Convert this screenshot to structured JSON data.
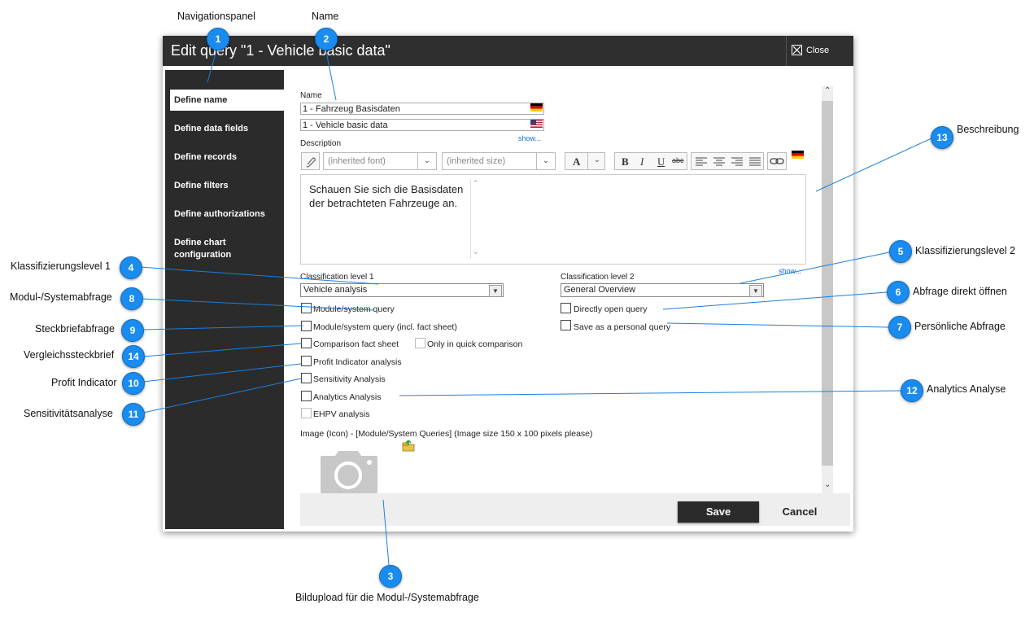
{
  "annotations": {
    "navigationspanel": "Navigationspanel",
    "name": "Name",
    "beschreibung": "Beschreibung",
    "klass1": "Klassifizierungslevel 1",
    "klass2": "Klassifizierungslevel 2",
    "modul": "Modul-/Systemabfrage",
    "abfrage_direkt": "Abfrage direkt öffnen",
    "steckbrief": "Steckbriefabfrage",
    "persoenlich": "Persönliche Abfrage",
    "vergleich": "Vergleichssteckbrief",
    "profit": "Profit Indicator",
    "analytics": "Analytics Analyse",
    "sensitivitaet": "Sensitivitätsanalyse",
    "bildupload": "Bildupload für die Modul-/Systemabfrage"
  },
  "badges": {
    "b1": "1",
    "b2": "2",
    "b3": "3",
    "b4": "4",
    "b5": "5",
    "b6": "6",
    "b7": "7",
    "b8": "8",
    "b9": "9",
    "b10": "10",
    "b11": "11",
    "b12": "12",
    "b13": "13",
    "b14": "14"
  },
  "dialog": {
    "title": "Edit query \"1 - Vehicle basic data\"",
    "close_label": "Close"
  },
  "sidebar": {
    "items": [
      {
        "label": "Define name"
      },
      {
        "label": "Define data fields"
      },
      {
        "label": "Define records"
      },
      {
        "label": "Define filters"
      },
      {
        "label": "Define authorizations"
      },
      {
        "label": "Define chart configuration"
      }
    ]
  },
  "form": {
    "name_label": "Name",
    "name_de": "1 - Fahrzeug Basisdaten",
    "name_en": "1 - Vehicle basic data",
    "show_link": "show...",
    "description_label": "Description",
    "font_placeholder": "(inherited font)",
    "size_placeholder": "(inherited size)",
    "toolbar": {
      "bold": "B",
      "italic": "I",
      "underline": "U",
      "strike": "abc",
      "font_color": "A"
    },
    "description_text": "Schauen Sie sich die Basisdaten der betrachteten Fahrzeuge an.",
    "show_link2": "show...",
    "class1_label": "Classification level 1",
    "class1_value": "Vehicle analysis",
    "class2_label": "Classification level 2",
    "class2_value": "General Overview",
    "checkboxes": {
      "module": "Module/system query",
      "module_fact": "Module/system query (incl. fact sheet)",
      "comparison": "Comparison fact sheet",
      "quick_comparison": "Only in quick comparison",
      "profit": "Profit Indicator analysis",
      "sensitivity": "Sensitivity Analysis",
      "analytics": "Analytics Analysis",
      "ehpv": "EHPV analysis",
      "directly_open": "Directly open query",
      "personal": "Save as a personal query"
    },
    "image_label": "Image (Icon) - [Module/System Queries] (Image size 150 x 100 pixels please)"
  },
  "buttons": {
    "save": "Save",
    "cancel": "Cancel"
  },
  "colors": {
    "accent": "#1a8cf0",
    "sidebar": "#2b2b2b",
    "titlebar": "#2f2f2f"
  }
}
